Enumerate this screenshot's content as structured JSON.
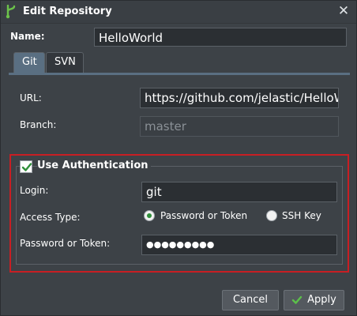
{
  "window": {
    "title": "Edit Repository",
    "icon": "jelastic-branch-icon",
    "close_icon": "close-icon"
  },
  "form": {
    "name_label": "Name:",
    "name_value": "HelloWorld"
  },
  "tabs": [
    {
      "label": "Git",
      "active": true
    },
    {
      "label": "SVN",
      "active": false
    }
  ],
  "git": {
    "url_label": "URL:",
    "url_value": "https://github.com/jelastic/HelloWor",
    "branch_label": "Branch:",
    "branch_placeholder": "master"
  },
  "auth": {
    "checkbox_checked": true,
    "title": "Use Authentication",
    "login_label": "Login:",
    "login_value": "git",
    "access_type_label": "Access Type:",
    "access_options": [
      {
        "label": "Password or Token",
        "selected": true
      },
      {
        "label": "SSH Key",
        "selected": false
      }
    ],
    "password_label": "Password or Token:",
    "password_value": "●●●●●●●●●"
  },
  "buttons": {
    "cancel": "Cancel",
    "apply": "Apply"
  },
  "colors": {
    "accent_tab": "#5a6f82",
    "highlight_border": "#c81e23",
    "check_green": "#2f8f3a",
    "dialog_bg": "#3d4247"
  }
}
